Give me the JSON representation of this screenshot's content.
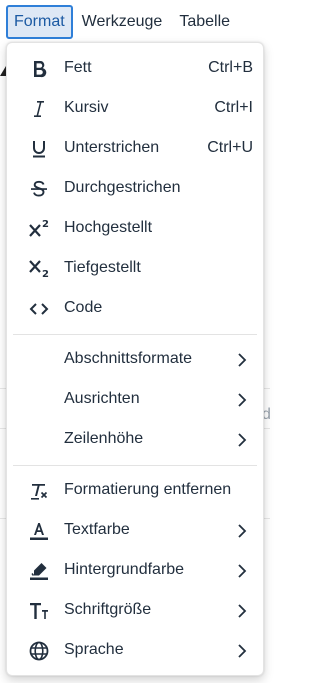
{
  "menubar": {
    "items": [
      {
        "label": "Format",
        "active": true
      },
      {
        "label": "Werkzeuge"
      },
      {
        "label": "Tabelle"
      }
    ]
  },
  "background": {
    "partial_char": "d"
  },
  "colors": {
    "accent": "#2f7fd8",
    "active_bg": "#dee8f5",
    "text": "#222f3e"
  },
  "menu": {
    "group1": [
      {
        "label": "Fett",
        "shortcut": "Ctrl+B",
        "icon": "bold-icon"
      },
      {
        "label": "Kursiv",
        "shortcut": "Ctrl+I",
        "icon": "italic-icon"
      },
      {
        "label": "Unterstrichen",
        "shortcut": "Ctrl+U",
        "icon": "underline-icon"
      },
      {
        "label": "Durchgestrichen",
        "icon": "strikethrough-icon"
      },
      {
        "label": "Hochgestellt",
        "icon": "superscript-icon"
      },
      {
        "label": "Tiefgestellt",
        "icon": "subscript-icon"
      },
      {
        "label": "Code",
        "icon": "code-icon"
      }
    ],
    "group2": [
      {
        "label": "Abschnittsformate",
        "submenu": true
      },
      {
        "label": "Ausrichten",
        "submenu": true
      },
      {
        "label": "Zeilenhöhe",
        "submenu": true
      }
    ],
    "group3": [
      {
        "label": "Formatierung entfernen",
        "icon": "remove-format-icon"
      },
      {
        "label": "Textfarbe",
        "icon": "text-color-icon",
        "submenu": true
      },
      {
        "label": "Hintergrundfarbe",
        "icon": "highlight-color-icon",
        "submenu": true
      },
      {
        "label": "Schriftgröße",
        "icon": "font-size-icon",
        "submenu": true
      },
      {
        "label": "Sprache",
        "icon": "language-icon",
        "submenu": true
      }
    ]
  }
}
